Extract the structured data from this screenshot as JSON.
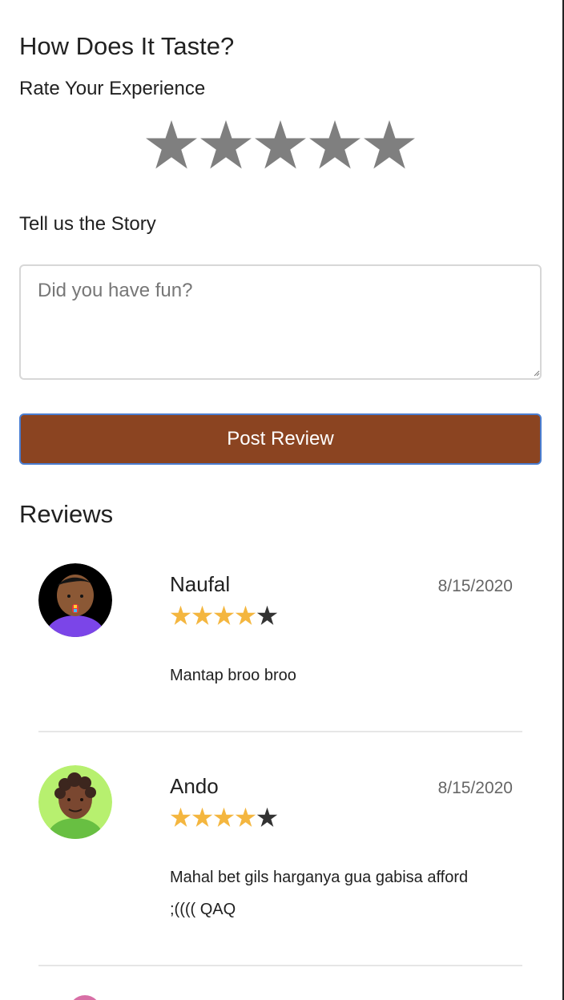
{
  "form": {
    "title": "How Does It Taste?",
    "rating_label": "Rate Your Experience",
    "rating_value": 0,
    "rating_max": 5,
    "story_label": "Tell us the Story",
    "story_placeholder": "Did you have fun?",
    "story_value": "",
    "submit_label": "Post Review"
  },
  "reviews": {
    "heading": "Reviews",
    "items": [
      {
        "name": "Naufal",
        "date": "8/15/2020",
        "rating": 4,
        "rating_max": 5,
        "text": "Mantap broo broo",
        "avatar_bg": "#000000"
      },
      {
        "name": "Ando",
        "date": "8/15/2020",
        "rating": 4,
        "rating_max": 5,
        "text": "Mahal bet gils harganya gua gabisa afford ;(((( QAQ",
        "avatar_bg": "#b7f06f"
      }
    ]
  },
  "colors": {
    "button_bg": "#8b4421",
    "button_border": "#4a7dd0",
    "star_filled": "#f4b63f",
    "star_empty_review": "#333333",
    "star_empty_rating": "#7f7f7f"
  }
}
